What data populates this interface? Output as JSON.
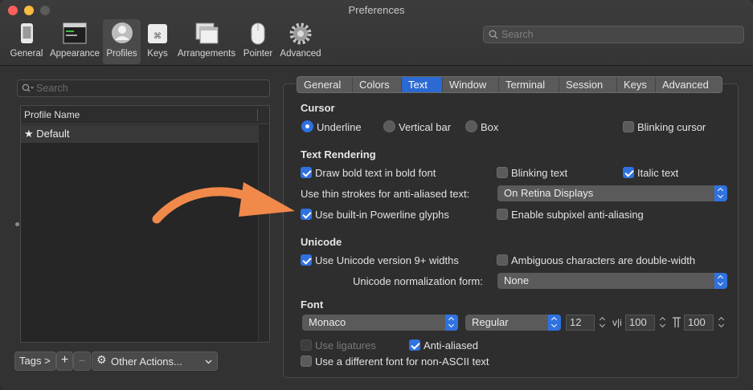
{
  "window": {
    "title": "Preferences"
  },
  "toolbar": {
    "items": [
      {
        "label": "General",
        "icon": "general-icon"
      },
      {
        "label": "Appearance",
        "icon": "appearance-icon"
      },
      {
        "label": "Profiles",
        "icon": "profiles-icon",
        "selected": true
      },
      {
        "label": "Keys",
        "icon": "keys-icon"
      },
      {
        "label": "Arrangements",
        "icon": "arrangements-icon"
      },
      {
        "label": "Pointer",
        "icon": "pointer-icon"
      },
      {
        "label": "Advanced",
        "icon": "gear-icon"
      }
    ],
    "search_placeholder": "Search"
  },
  "profiles": {
    "search_placeholder": "Search",
    "column_header": "Profile Name",
    "rows": [
      {
        "star": "★",
        "name": "Default"
      }
    ],
    "tags_label": "Tags >",
    "add_label": "+",
    "remove_label": "−",
    "other_actions_label": "Other Actions..."
  },
  "tabs": [
    "General",
    "Colors",
    "Text",
    "Window",
    "Terminal",
    "Session",
    "Keys",
    "Advanced"
  ],
  "selected_tab": "Text",
  "cursor": {
    "title": "Cursor",
    "underline": "Underline",
    "vertical_bar": "Vertical bar",
    "box": "Box",
    "selected": "Underline",
    "blinking": "Blinking cursor",
    "blinking_checked": false
  },
  "text_rendering": {
    "title": "Text Rendering",
    "bold": "Draw bold text in bold font",
    "bold_checked": true,
    "blinking_text": "Blinking text",
    "blinking_text_checked": false,
    "italic": "Italic text",
    "italic_checked": true,
    "thin_strokes_label": "Use thin strokes for anti-aliased text:",
    "thin_strokes_value": "On Retina Displays",
    "powerline": "Use built-in Powerline glyphs",
    "powerline_checked": true,
    "subpixel": "Enable subpixel anti-aliasing",
    "subpixel_checked": false
  },
  "unicode": {
    "title": "Unicode",
    "v9": "Use Unicode version 9+ widths",
    "v9_checked": true,
    "ambiguous": "Ambiguous characters are double-width",
    "ambiguous_checked": false,
    "normalization_label": "Unicode normalization form:",
    "normalization_value": "None"
  },
  "font": {
    "title": "Font",
    "family": "Monaco",
    "style": "Regular",
    "size": "12",
    "vertical_spacing": "100",
    "horizontal_spacing": "100",
    "ligatures": "Use ligatures",
    "ligatures_checked": false,
    "ligatures_disabled": true,
    "anti_aliased": "Anti-aliased",
    "anti_aliased_checked": true,
    "non_ascii": "Use a different font for non-ASCII text",
    "non_ascii_checked": false
  },
  "colors": {
    "accent": "#2f72e0",
    "arrow": "#f0894a",
    "close": "#fc605c",
    "minimize": "#fdbc40",
    "zoom": "#5b5b5b"
  }
}
